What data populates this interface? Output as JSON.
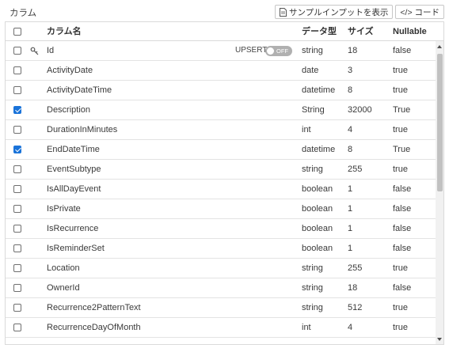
{
  "panel": {
    "title": "カラム"
  },
  "toolbar": {
    "sample_input_label": "サンプルインプットを表示",
    "code_label": "</> コード"
  },
  "columns": {
    "name": "カラム名",
    "type": "データ型",
    "size": "サイズ",
    "nullable": "Nullable"
  },
  "upsert": {
    "label": "UPSERT",
    "toggle_text": "OFF",
    "state": "off"
  },
  "rows": [
    {
      "checked": false,
      "key": true,
      "name": "Id",
      "type": "string",
      "size": "18",
      "nullable": "false"
    },
    {
      "checked": false,
      "key": false,
      "name": "ActivityDate",
      "type": "date",
      "size": "3",
      "nullable": "true"
    },
    {
      "checked": false,
      "key": false,
      "name": "ActivityDateTime",
      "type": "datetime",
      "size": "8",
      "nullable": "true"
    },
    {
      "checked": true,
      "key": false,
      "name": "Description",
      "type": "String",
      "size": "32000",
      "nullable": "True"
    },
    {
      "checked": false,
      "key": false,
      "name": "DurationInMinutes",
      "type": "int",
      "size": "4",
      "nullable": "true"
    },
    {
      "checked": true,
      "key": false,
      "name": "EndDateTime",
      "type": "datetime",
      "size": "8",
      "nullable": "True"
    },
    {
      "checked": false,
      "key": false,
      "name": "EventSubtype",
      "type": "string",
      "size": "255",
      "nullable": "true"
    },
    {
      "checked": false,
      "key": false,
      "name": "IsAllDayEvent",
      "type": "boolean",
      "size": "1",
      "nullable": "false"
    },
    {
      "checked": false,
      "key": false,
      "name": "IsPrivate",
      "type": "boolean",
      "size": "1",
      "nullable": "false"
    },
    {
      "checked": false,
      "key": false,
      "name": "IsRecurrence",
      "type": "boolean",
      "size": "1",
      "nullable": "false"
    },
    {
      "checked": false,
      "key": false,
      "name": "IsReminderSet",
      "type": "boolean",
      "size": "1",
      "nullable": "false"
    },
    {
      "checked": false,
      "key": false,
      "name": "Location",
      "type": "string",
      "size": "255",
      "nullable": "true"
    },
    {
      "checked": false,
      "key": false,
      "name": "OwnerId",
      "type": "string",
      "size": "18",
      "nullable": "false"
    },
    {
      "checked": false,
      "key": false,
      "name": "Recurrence2PatternText",
      "type": "string",
      "size": "512",
      "nullable": "true"
    },
    {
      "checked": false,
      "key": false,
      "name": "RecurrenceDayOfMonth",
      "type": "int",
      "size": "4",
      "nullable": "true"
    }
  ],
  "colors": {
    "accent": "#1a73d9",
    "toggle_off": "#b0b0b0"
  }
}
